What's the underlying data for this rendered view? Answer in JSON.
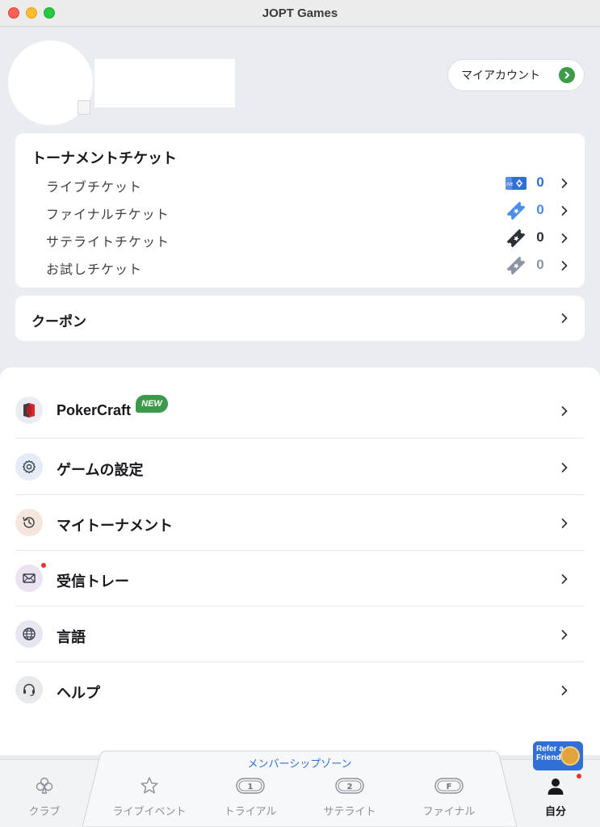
{
  "window": {
    "title": "JOPT Games"
  },
  "profile": {
    "account_button_label": "マイアカウント"
  },
  "tickets": {
    "title": "トーナメントチケット",
    "rows": [
      {
        "label": "ライブチケット",
        "count": "0",
        "icon": "live-ticket-icon",
        "color": "#2f6fd6"
      },
      {
        "label": "ファイナルチケット",
        "count": "0",
        "icon": "final-ticket-icon",
        "color": "#4a8de8"
      },
      {
        "label": "サテライトチケット",
        "count": "0",
        "icon": "satellite-ticket-icon",
        "color": "#2b2f36"
      },
      {
        "label": "お試しチケット",
        "count": "0",
        "icon": "trial-ticket-icon",
        "color": "#8a94a3"
      }
    ]
  },
  "coupon": {
    "label": "クーポン"
  },
  "menu": {
    "items": [
      {
        "label": "PokerCraft",
        "icon": "pokercraft-icon",
        "badge": "NEW"
      },
      {
        "label": "ゲームの設定",
        "icon": "gear-icon"
      },
      {
        "label": "マイトーナメント",
        "icon": "history-icon"
      },
      {
        "label": "受信トレー",
        "icon": "mail-icon",
        "has_notification": true
      },
      {
        "label": "言語",
        "icon": "globe-icon"
      },
      {
        "label": "ヘルプ",
        "icon": "headset-icon"
      }
    ]
  },
  "bottom_nav": {
    "membership_zone_label": "メンバーシップゾーン",
    "refer_badge": {
      "line1": "Refer a",
      "line2": "Friend"
    },
    "items": [
      {
        "label": "クラブ",
        "icon": "club-icon"
      },
      {
        "label": "ライブイベント",
        "icon": "star-icon"
      },
      {
        "label": "トライアル",
        "icon": "trial-1-icon",
        "glyph": "1"
      },
      {
        "label": "サテライト",
        "icon": "satellite-2-icon",
        "glyph": "2"
      },
      {
        "label": "ファイナル",
        "icon": "final-f-icon",
        "glyph": "F"
      },
      {
        "label": "自分",
        "icon": "person-icon",
        "active": true
      }
    ]
  },
  "colors": {
    "accent_green": "#3d9b49",
    "accent_blue": "#2f6fd6",
    "notification_red": "#e8342c"
  }
}
